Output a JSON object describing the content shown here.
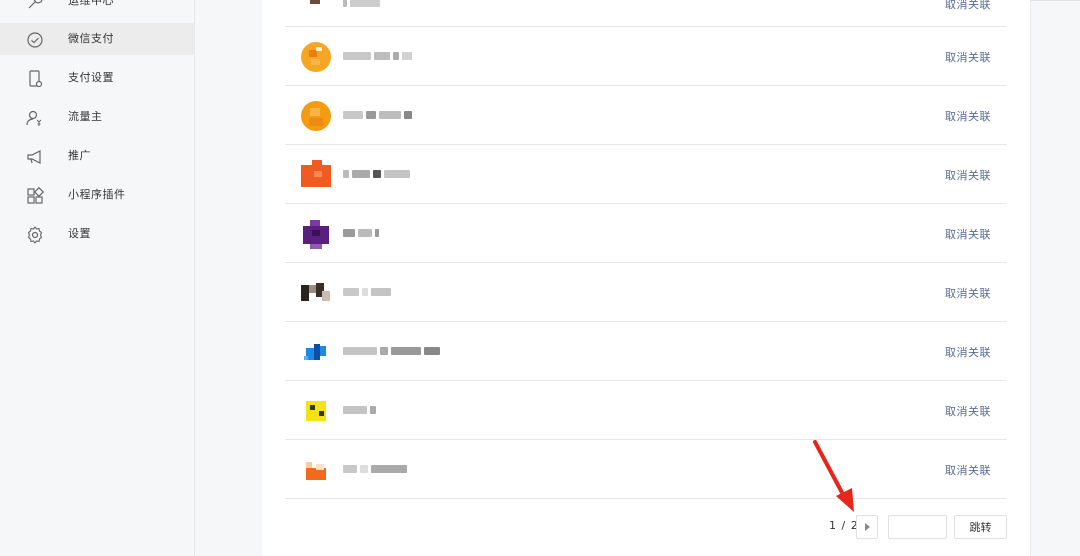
{
  "sidebar": {
    "items": [
      {
        "label": "运维中心",
        "icon": "wrench-icon"
      },
      {
        "label": "微信支付",
        "icon": "check-circle-icon",
        "active": true
      },
      {
        "label": "支付设置",
        "icon": "phone-settings-icon"
      },
      {
        "label": "流量主",
        "icon": "user-yen-icon"
      },
      {
        "label": "推广",
        "icon": "megaphone-icon"
      },
      {
        "label": "小程序插件",
        "icon": "plugin-grid-icon"
      },
      {
        "label": "设置",
        "icon": "gear-icon"
      }
    ]
  },
  "list": {
    "unlink_label": "取消关联",
    "rows": [
      {
        "avatar_color": "#6b4a3a"
      },
      {
        "avatar_color": "#f5a623"
      },
      {
        "avatar_color": "#f39c12"
      },
      {
        "avatar_color": "#f15a22"
      },
      {
        "avatar_color": "#5b1f80"
      },
      {
        "avatar_color": "#3a2f28"
      },
      {
        "avatar_color": "#1e88e5"
      },
      {
        "avatar_color": "#f5e11a"
      },
      {
        "avatar_color": "#f26b1d"
      }
    ]
  },
  "pager": {
    "page_text": "1 / 2",
    "jump_label": "跳转"
  },
  "colors": {
    "link": "#576b95",
    "annotation_arrow": "#e8251b"
  }
}
